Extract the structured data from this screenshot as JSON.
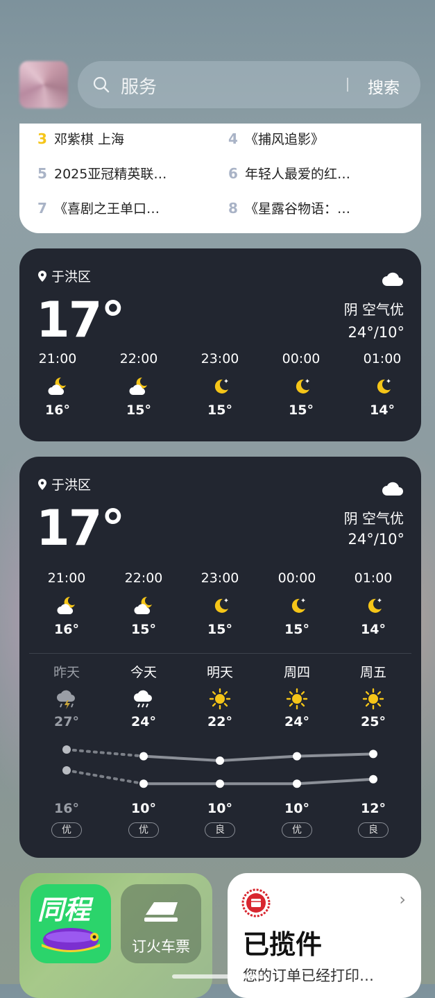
{
  "search": {
    "placeholder": "服务",
    "button": "搜索"
  },
  "hot_list": [
    {
      "rank": "3",
      "title": "邓紫棋 上海",
      "rank_color": "#f5c518"
    },
    {
      "rank": "4",
      "title": "《捕风追影》",
      "rank_color": "#a9b3c6"
    },
    {
      "rank": "5",
      "title": "2025亚冠精英联…",
      "rank_color": "#a9b3c6"
    },
    {
      "rank": "6",
      "title": "年轻人最爱的红…",
      "rank_color": "#a9b3c6"
    },
    {
      "rank": "7",
      "title": "《喜剧之王单口…",
      "rank_color": "#a9b3c6"
    },
    {
      "rank": "8",
      "title": "《星露谷物语：…",
      "rank_color": "#a9b3c6"
    }
  ],
  "weather_small": {
    "location": "于洪区",
    "temperature": "17°",
    "condition": "阴  空气优",
    "range": "24°/10°",
    "hourly": [
      {
        "time": "21:00",
        "icon": "cloud-moon-icon",
        "temp": "16°"
      },
      {
        "time": "22:00",
        "icon": "cloud-moon-icon",
        "temp": "15°"
      },
      {
        "time": "23:00",
        "icon": "moon-icon",
        "temp": "15°"
      },
      {
        "time": "00:00",
        "icon": "moon-icon",
        "temp": "15°"
      },
      {
        "time": "01:00",
        "icon": "moon-icon",
        "temp": "14°"
      }
    ]
  },
  "weather_large": {
    "location": "于洪区",
    "temperature": "17°",
    "condition": "阴  空气优",
    "range": "24°/10°",
    "hourly": [
      {
        "time": "21:00",
        "icon": "cloud-moon-icon",
        "temp": "16°"
      },
      {
        "time": "22:00",
        "icon": "cloud-moon-icon",
        "temp": "15°"
      },
      {
        "time": "23:00",
        "icon": "moon-icon",
        "temp": "15°"
      },
      {
        "time": "00:00",
        "icon": "moon-icon",
        "temp": "15°"
      },
      {
        "time": "01:00",
        "icon": "moon-icon",
        "temp": "14°"
      }
    ],
    "daily": [
      {
        "day": "昨天",
        "icon": "thunderstorm-icon",
        "high": "27°",
        "low": "16°",
        "aqi": "优",
        "high_value": 27,
        "low_value": 16
      },
      {
        "day": "今天",
        "icon": "rain-icon",
        "high": "24°",
        "low": "10°",
        "aqi": "优",
        "high_value": 24,
        "low_value": 10
      },
      {
        "day": "明天",
        "icon": "sun-icon",
        "high": "22°",
        "low": "10°",
        "aqi": "良",
        "high_value": 22,
        "low_value": 10
      },
      {
        "day": "周四",
        "icon": "sun-icon",
        "high": "24°",
        "low": "10°",
        "aqi": "优",
        "high_value": 24,
        "low_value": 10
      },
      {
        "day": "周五",
        "icon": "sun-icon",
        "high": "25°",
        "low": "12°",
        "aqi": "良",
        "high_value": 25,
        "low_value": 12
      }
    ]
  },
  "apps": {
    "tongcheng_label": "同程",
    "train_label": "订火车票"
  },
  "express": {
    "title": "已揽件",
    "subtitle": "您的订单已经打印…"
  },
  "colors": {
    "accent_yellow": "#f5c518",
    "widget_bg": "#222630"
  }
}
